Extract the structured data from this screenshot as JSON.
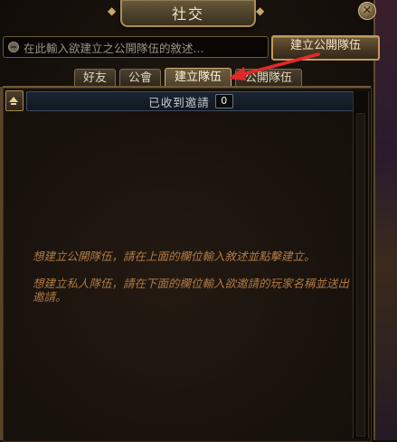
{
  "window": {
    "title": "社交",
    "close_symbol": "×"
  },
  "search": {
    "placeholder": "在此輸入欲建立之公開隊伍的敘述...",
    "icon": "message-bubble-icon"
  },
  "buttons": {
    "create_public_party": "建立公開隊伍"
  },
  "tabs": [
    {
      "label": "好友",
      "active": false
    },
    {
      "label": "公會",
      "active": false
    },
    {
      "label": "建立隊伍",
      "active": true
    },
    {
      "label": "公開隊伍",
      "active": false
    }
  ],
  "invites": {
    "label": "已收到邀請",
    "count": "0"
  },
  "messages": {
    "public_party": "想建立公開隊伍，請在上面的欄位輸入敘述並點擊建立。",
    "private_party": "想建立私人隊伍，請在下面的欄位輸入欲邀請的玩家名稱並送出邀請。"
  },
  "colors": {
    "accent_gold": "#c09a5a",
    "hint_text": "#b07a45",
    "annotation_arrow": "#e02a2a"
  }
}
